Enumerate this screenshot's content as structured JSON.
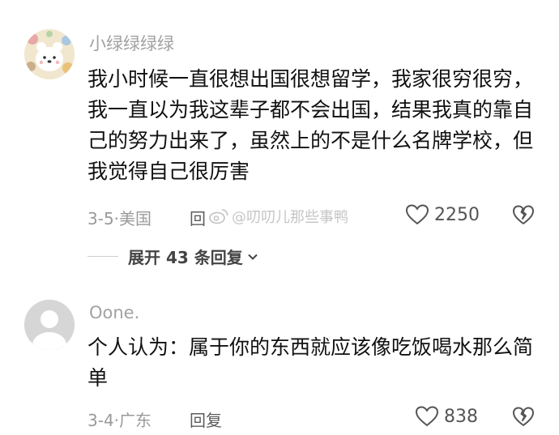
{
  "comments": [
    {
      "username": "小绿绿绿绿",
      "content": "我小时候一直很想出国很想留学，我家很穷很穷，我一直以为我这辈子都不会出国，结果我真的靠自己的努力出来了，虽然上的不是什么名牌学校，但我觉得自己很厉害",
      "date": "3-5",
      "location": "美国",
      "reply_label": "回",
      "likes": "2250"
    },
    {
      "username": "Oone.",
      "content": "个人认为：属于你的东西就应该像吃饭喝水那么简单",
      "date": "3-4",
      "location": "广东",
      "reply_label": "回复",
      "likes": "838"
    }
  ],
  "expand_replies": {
    "label": "展开 43 条回复"
  },
  "watermark": {
    "text": "@叨叨儿那些事鸭"
  },
  "colors": {
    "meta_gray": "#9a9a9a",
    "username_gray": "#a2a2a2"
  }
}
